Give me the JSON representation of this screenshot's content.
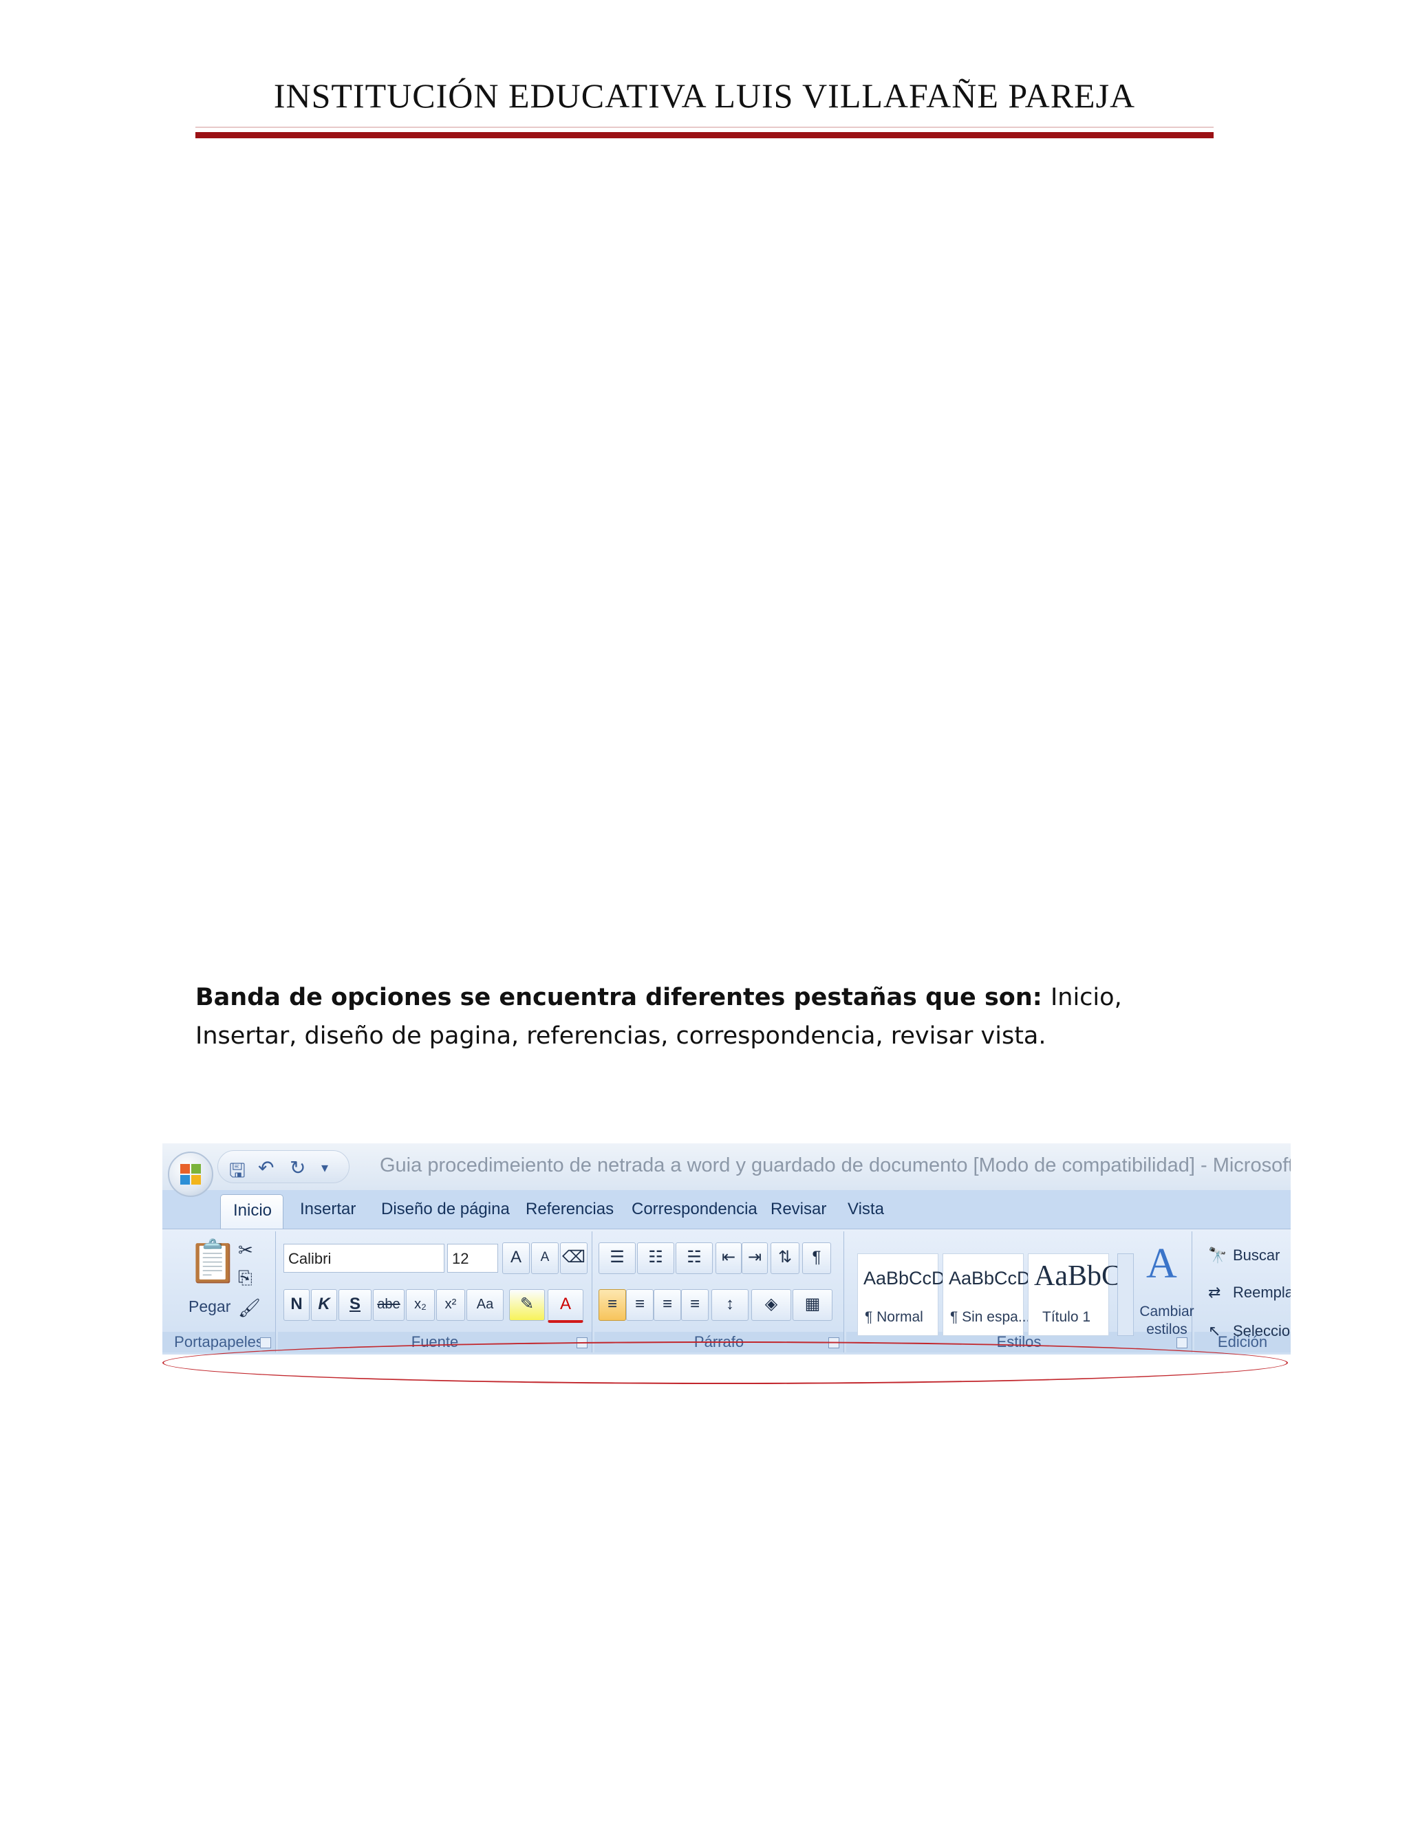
{
  "header": {
    "title": "INSTITUCIÓN EDUCATIVA LUIS VILLAFAÑE PAREJA"
  },
  "paragraph": {
    "bold_text": "Banda de opciones se encuentra diferentes pestañas que son: ",
    "line1_rest": "Inicio,",
    "line2": "Insertar, diseño de pagina, referencias, correspondencia, revisar vista."
  },
  "ribbon": {
    "window_title": "Guia procedimeiento de netrada a word y guardado de documento [Modo de compatibilidad] - Microsoft Word",
    "tabs": [
      "Inicio",
      "Insertar",
      "Diseño de página",
      "Referencias",
      "Correspondencia",
      "Revisar",
      "Vista"
    ],
    "groups": {
      "clipboard": {
        "label": "Portapapeles",
        "paste": "Pegar"
      },
      "font": {
        "label": "Fuente",
        "font_name": "Calibri",
        "font_size": "12",
        "bold": "N",
        "italic": "K",
        "underline": "S",
        "strike": "abe",
        "sub": "x₂",
        "sup": "x²",
        "case": "Aa"
      },
      "paragraph": {
        "label": "Párrafo",
        "pilcrow": "¶"
      },
      "styles": {
        "label": "Estilos",
        "items": [
          {
            "sample": "AaBbCcDc",
            "name": "¶ Normal"
          },
          {
            "sample": "AaBbCcDc",
            "name": "¶ Sin espa..."
          },
          {
            "sample": "AaBbC",
            "name": "Título 1"
          }
        ],
        "change": "Cambiar estilos"
      },
      "editing": {
        "label": "Edición",
        "find": "Buscar",
        "replace": "Reemplaz",
        "select": "Seleccion"
      }
    },
    "accent_color": "#c2272d"
  }
}
